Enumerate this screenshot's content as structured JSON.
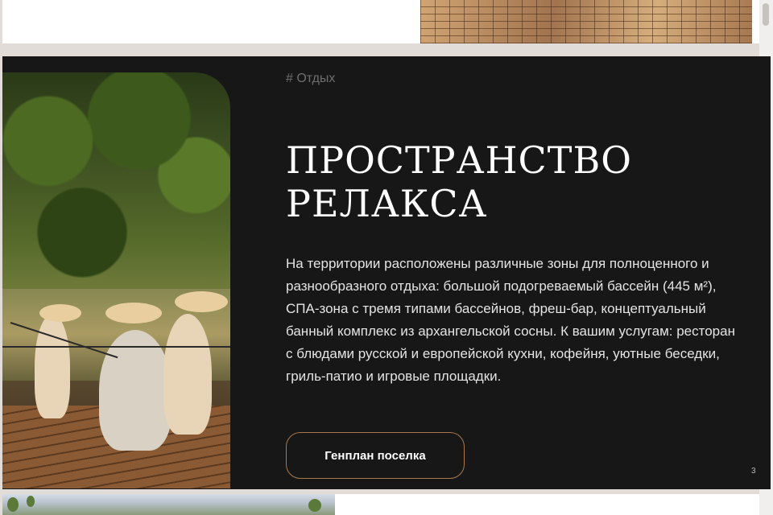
{
  "section": {
    "tag": "# Отдых",
    "title_line1": "ПРОСТРАНСТВО",
    "title_line2": "РЕЛАКСА",
    "description": "На территории расположены различные зоны для полноценного и разнообразного отдыха: большой подогреваемый бассейн (445 м²), СПА-зона с тремя типами бассейнов, фреш-бар, концептуальный банный комплекс из архангельской сосны. К вашим услугам: ресторан с блюдами русской и европейской кухни, кофейня, уютные беседки, гриль-патио и игровые площадки.",
    "button_label": "Генплан поселка",
    "page_number": "3"
  },
  "colors": {
    "section_background": "#171717",
    "button_border": "#a67a4e",
    "text": "#ffffff"
  }
}
